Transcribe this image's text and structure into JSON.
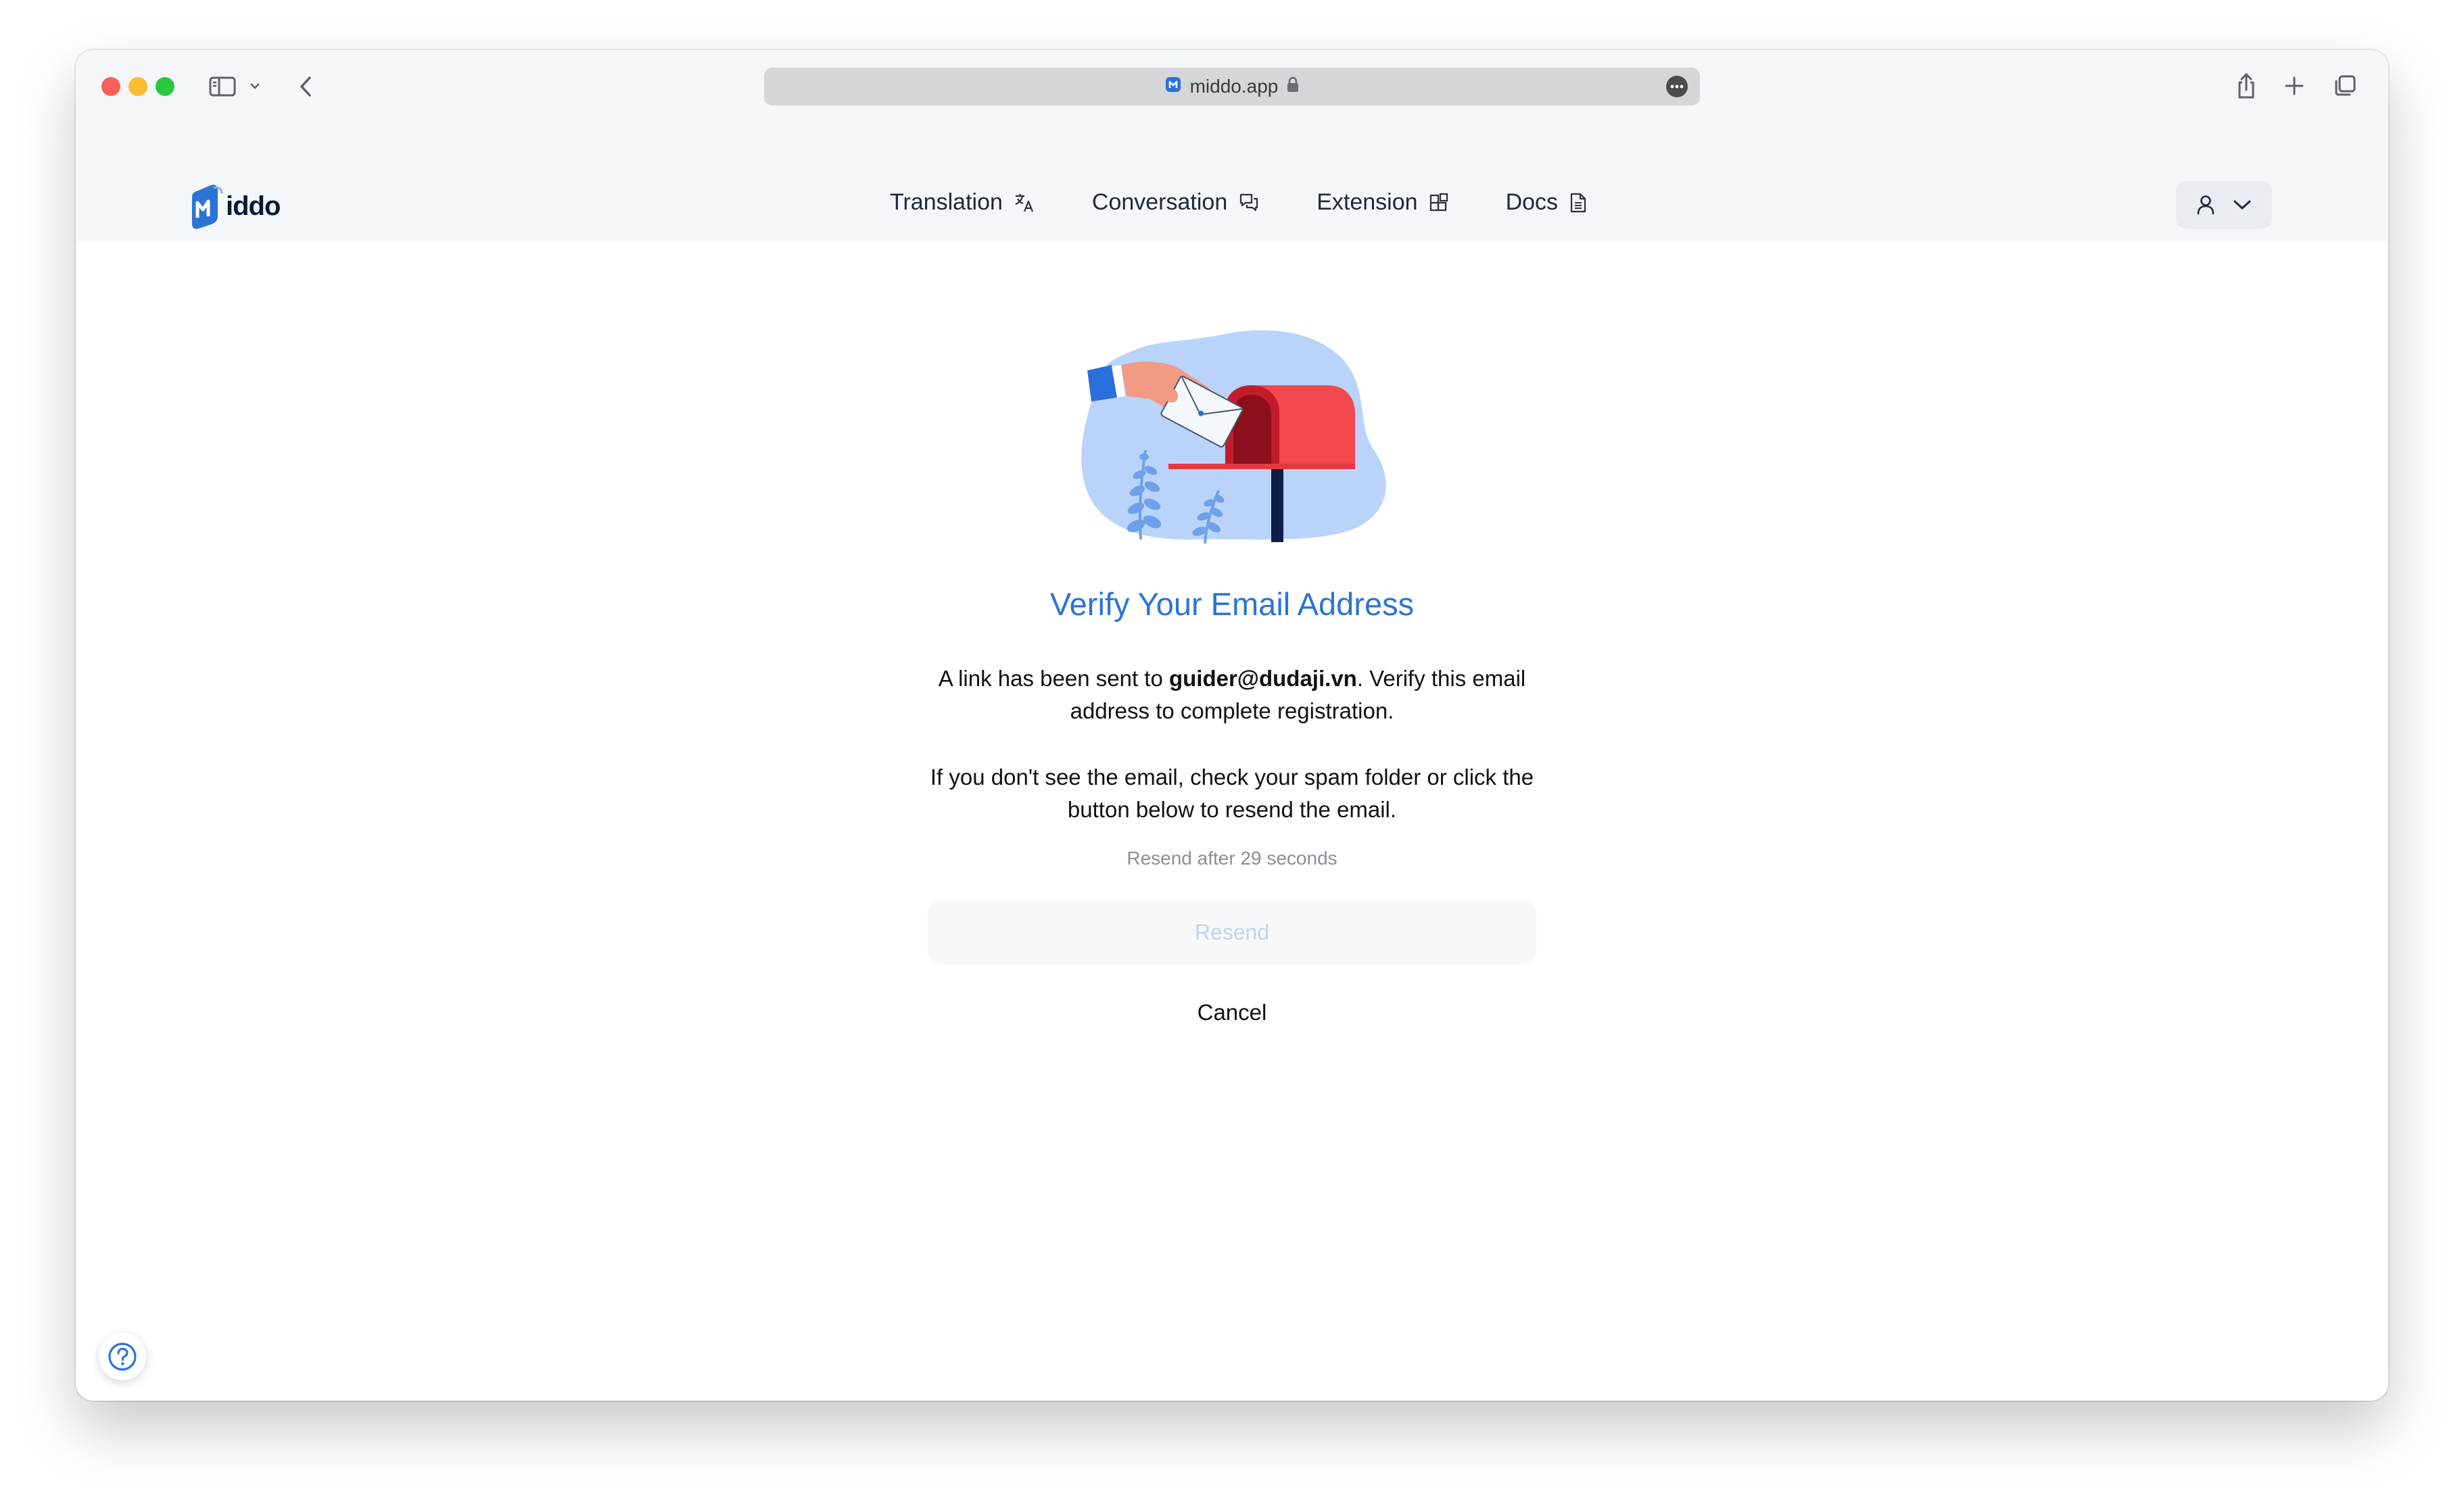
{
  "browser": {
    "url": "middo.app"
  },
  "header": {
    "logo_text": "iddo",
    "nav": [
      {
        "label": "Translation",
        "icon": "translate-icon"
      },
      {
        "label": "Conversation",
        "icon": "chat-bubbles-icon"
      },
      {
        "label": "Extension",
        "icon": "extension-icon"
      },
      {
        "label": "Docs",
        "icon": "document-icon"
      }
    ]
  },
  "main": {
    "title": "Verify Your Email Address",
    "paragraph1_prefix": "A link has been sent to ",
    "email": "guider@dudaji.vn",
    "paragraph1_suffix": ". Verify this email address to complete registration.",
    "paragraph2": "If you don't see the email, check your spam folder or click the button below to resend the email.",
    "resend_note": "Resend after 29 seconds",
    "resend_label": "Resend",
    "cancel_label": "Cancel"
  },
  "colors": {
    "accent": "#2a74d6",
    "title": "#2a74d6",
    "mailbox_red": "#f2484d",
    "illustration_bg": "#b9d3fa",
    "disabled_text": "#c3d3ea"
  }
}
